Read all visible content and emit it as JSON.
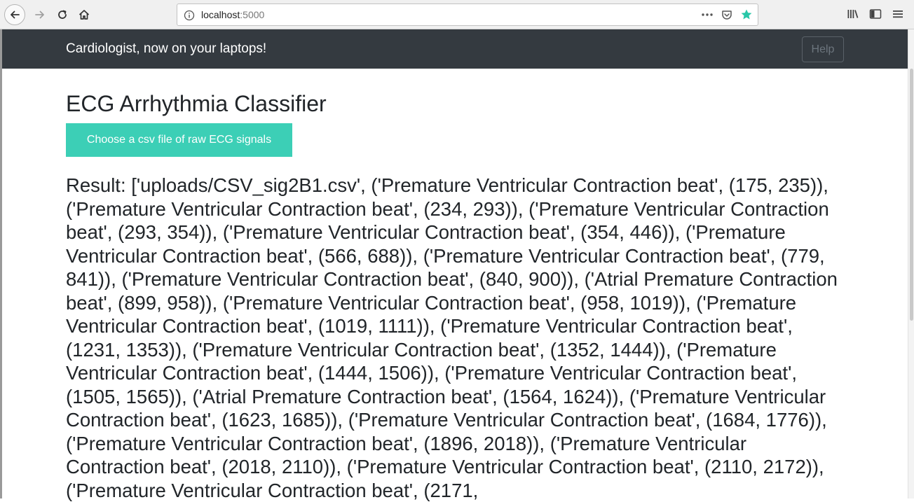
{
  "browser": {
    "url_host": "localhost",
    "url_port": ":5000",
    "icons": {
      "back": "arrow-left-icon",
      "forward": "arrow-right-icon",
      "reload": "reload-icon",
      "home": "home-icon",
      "info": "info-icon",
      "more": "more-horizontal-icon",
      "pocket": "pocket-icon",
      "bookmark": "star-icon",
      "library": "library-icon",
      "sidebar": "sidebar-icon",
      "menu": "menu-icon"
    },
    "colors": {
      "bookmark_star": "#28c7a8"
    }
  },
  "navbar": {
    "brand": "Cardiologist, now on your laptops!",
    "help_label": "Help"
  },
  "main": {
    "title": "ECG Arrhythmia Classifier",
    "upload_label": "Choose a csv file of raw ECG signals",
    "result_text": "Result: ['uploads/CSV_sig2B1.csv', ('Premature Ventricular Contraction beat', (175, 235)), ('Premature Ventricular Contraction beat', (234, 293)), ('Premature Ventricular Contraction beat', (293, 354)), ('Premature Ventricular Contraction beat', (354, 446)), ('Premature Ventricular Contraction beat', (566, 688)), ('Premature Ventricular Contraction beat', (779, 841)), ('Premature Ventricular Contraction beat', (840, 900)), ('Atrial Premature Contraction beat', (899, 958)), ('Premature Ventricular Contraction beat', (958, 1019)), ('Premature Ventricular Contraction beat', (1019, 1111)), ('Premature Ventricular Contraction beat', (1231, 1353)), ('Premature Ventricular Contraction beat', (1352, 1444)), ('Premature Ventricular Contraction beat', (1444, 1506)), ('Premature Ventricular Contraction beat', (1505, 1565)), ('Atrial Premature Contraction beat', (1564, 1624)), ('Premature Ventricular Contraction beat', (1623, 1685)), ('Premature Ventricular Contraction beat', (1684, 1776)), ('Premature Ventricular Contraction beat', (1896, 2018)), ('Premature Ventricular Contraction beat', (2018, 2110)), ('Premature Ventricular Contraction beat', (2110, 2172)), ('Premature Ventricular Contraction beat', (2171,"
  },
  "colors": {
    "navbar_bg": "#343a40",
    "upload_button": "#3ccfb6"
  }
}
